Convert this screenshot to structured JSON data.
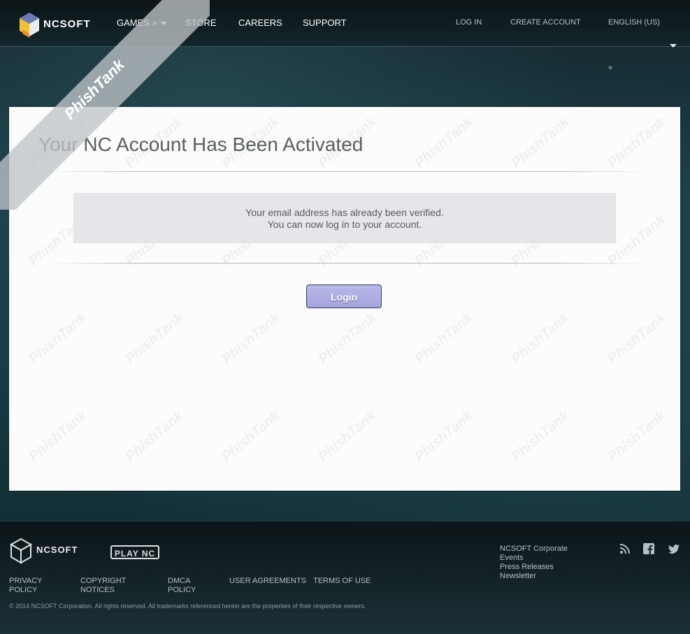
{
  "header": {
    "brand": "NCSOFT",
    "nav": {
      "games": "GAMES »",
      "store": "STORE",
      "careers": "CAREERS",
      "support": "SUPPORT"
    },
    "right_nav": {
      "login": "LOG IN",
      "create_account": "CREATE ACCOUNT",
      "language": "ENGLISH (US)"
    },
    "raquo": "»"
  },
  "ribbon": {
    "text": "PhishTank"
  },
  "main": {
    "title": "Your NC Account Has Been Activated",
    "notice": {
      "line1": "Your email address has already been verified.",
      "line2": "You can now log in to your account."
    },
    "login_button": "Login"
  },
  "footer": {
    "brand": "NCSOFT",
    "plaync": "PLAY NC",
    "links": {
      "privacy_1": "PRIVACY",
      "privacy_2": "POLICY",
      "copyright_1": "COPYRIGHT",
      "copyright_2": "NOTICES",
      "dmca_1": "DMCA",
      "dmca_2": "POLICY",
      "user_agreements": "USER AGREEMENTS",
      "terms": "TERMS OF USE"
    },
    "corporate": {
      "corporate": "NCSOFT Corporate",
      "events": "Events",
      "press": "Press Releases",
      "newsletter": "Newsletter"
    },
    "copyright_text": "© 2014 NCSOFT Corporation. All rights reserved. All trademarks referenced herein are the properties of their respective owners.",
    "social_icons": [
      "rss-icon",
      "facebook-icon",
      "twitter-icon"
    ]
  },
  "colors": {
    "button": "#a3a4dc",
    "card": "#fbfcfb",
    "header": "#0b1417"
  }
}
